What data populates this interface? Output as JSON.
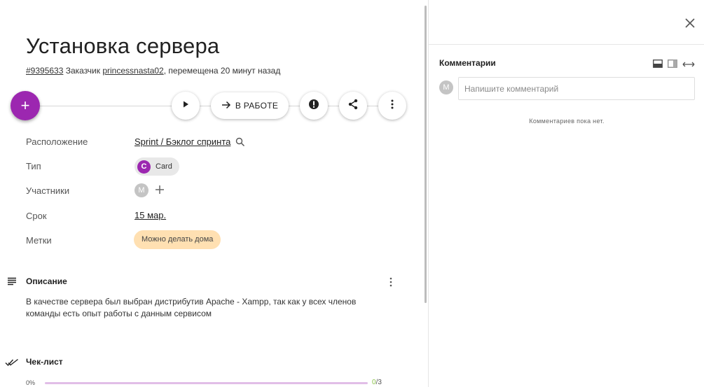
{
  "task": {
    "title": "Установка сервера",
    "id_link": "#9395633",
    "customer_label": " Заказчик ",
    "customer": "princessnasta02",
    "moved_text": ", перемещена 20 минут назад"
  },
  "toolbar": {
    "add_label": "+",
    "status_label": "В РАБОТЕ"
  },
  "properties": {
    "location": {
      "label": "Расположение",
      "value": "Sprint / Бэклог спринта"
    },
    "type": {
      "label": "Тип",
      "avatar_letter": "C",
      "value": "Card"
    },
    "members": {
      "label": "Участники",
      "avatar_letter": "M"
    },
    "due": {
      "label": "Срок",
      "value": "15 мар."
    },
    "tags": {
      "label": "Метки",
      "value": "Можно делать дома"
    }
  },
  "description": {
    "heading": "Описание",
    "text": "В качестве сервера был выбран дистрибутив Apache - Xampp, так как у всех членов команды есть опыт работы с данным сервисом"
  },
  "checklist": {
    "heading": "Чек-лист",
    "percent_label": "0%",
    "progress": 0,
    "done": "0",
    "total": "/3"
  },
  "comments": {
    "heading": "Комментарии",
    "avatar_letter": "M",
    "placeholder": "Напишите комментарий",
    "empty_text": "Комментариев пока нет."
  },
  "colors": {
    "accent": "#9c27b0",
    "tag_bg": "#ffe0b2",
    "progress_track": "#e1bee7"
  },
  "icons": [
    "plus-icon",
    "play-icon",
    "arrow-right-icon",
    "alert-icon",
    "share-icon",
    "more-vert-icon",
    "search-icon",
    "subject-icon",
    "done-all-icon",
    "close-icon",
    "panel-bottom-icon",
    "panel-side-icon",
    "expand-horizontal-icon"
  ]
}
